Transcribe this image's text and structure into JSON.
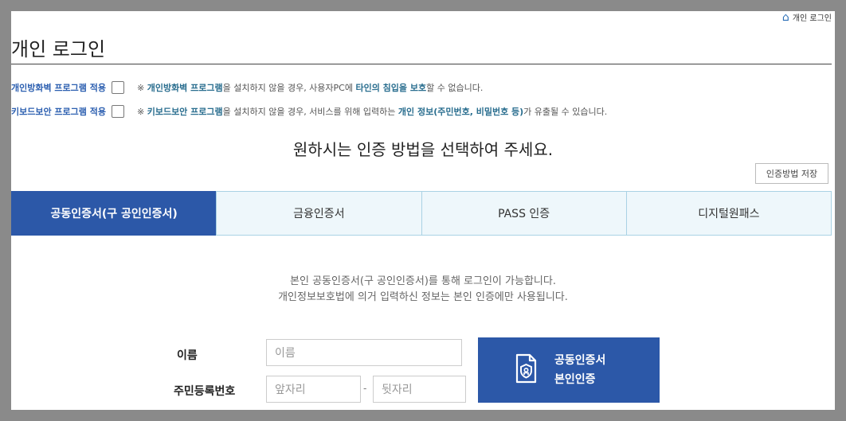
{
  "header": {
    "top_link_label": "개인 로그인",
    "title": "개인 로그인"
  },
  "options": [
    {
      "label": "개인방화벽 프로그램 적용",
      "note_prefix": "※ ",
      "note_program": "개인방화벽 프로그램",
      "note_mid": "을 설치하지 않을 경우, 사용자PC에 ",
      "note_highlight": "타인의 침입을 보호",
      "note_suffix": "할 수 없습니다."
    },
    {
      "label": "키보드보안 프로그램 적용",
      "note_prefix": "※ ",
      "note_program": "키보드보안 프로그램",
      "note_mid": "을 설치하지 않을 경우, 서비스를 위해 입력하는 ",
      "note_highlight": "개인 정보(주민번호, 비밀번호 등)",
      "note_suffix": "가 유출될 수 있습니다."
    }
  ],
  "headline": "원하시는 인증 방법을 선택하여 주세요.",
  "save_method_label": "인증방법 저장",
  "tabs": [
    {
      "label": "공동인증서(구 공인인증서)",
      "active": true
    },
    {
      "label": "금융인증서",
      "active": false
    },
    {
      "label": "PASS 인증",
      "active": false
    },
    {
      "label": "디지털원패스",
      "active": false
    }
  ],
  "description": {
    "line1": "본인 공동인증서(구 공인인증서)를 통해 로그인이 가능합니다.",
    "line2": "개인정보보호법에 의거 입력하신 정보는 본인 인증에만 사용됩니다."
  },
  "form": {
    "name_label": "이름",
    "name_placeholder": "이름",
    "rrn_label": "주민등록번호",
    "rrn_front_placeholder": "앞자리",
    "rrn_separator": "-",
    "rrn_back_placeholder": "뒷자리"
  },
  "cert_button": {
    "line1": "공동인증서",
    "line2": "본인인증"
  },
  "colors": {
    "accent": "#2c58a8",
    "tab_bg": "#eef7fb",
    "tab_border": "#a9d2e4",
    "label_blue": "#2c5fb0",
    "highlight_teal": "#2a6e8f"
  }
}
